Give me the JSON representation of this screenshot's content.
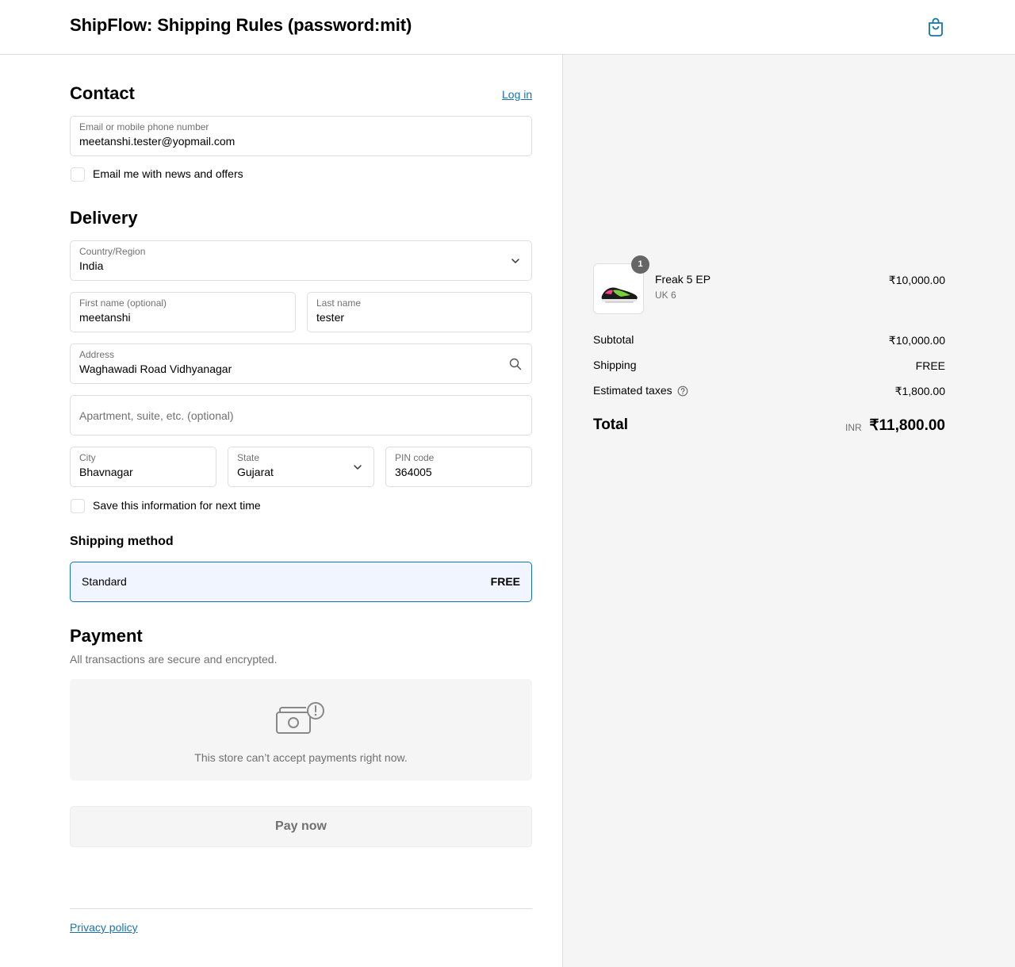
{
  "header": {
    "title": "ShipFlow: Shipping Rules (password:mit)",
    "cart_icon": "shopping-bag-icon"
  },
  "contact": {
    "heading": "Contact",
    "login_label": "Log in",
    "email": {
      "label": "Email or mobile phone number",
      "value": "meetanshi.tester@yopmail.com"
    },
    "news_label": "Email me with news and offers"
  },
  "delivery": {
    "heading": "Delivery",
    "country": {
      "label": "Country/Region",
      "value": "India"
    },
    "first_name": {
      "label": "First name (optional)",
      "value": "meetanshi"
    },
    "last_name": {
      "label": "Last name",
      "value": "tester"
    },
    "address": {
      "label": "Address",
      "value": "Waghawadi Road Vidhyanagar"
    },
    "apartment": {
      "placeholder": "Apartment, suite, etc. (optional)"
    },
    "city": {
      "label": "City",
      "value": "Bhavnagar"
    },
    "state": {
      "label": "State",
      "value": "Gujarat"
    },
    "pin": {
      "label": "PIN code",
      "value": "364005"
    },
    "save_label": "Save this information for next time"
  },
  "shipping_method": {
    "heading": "Shipping method",
    "option": {
      "name": "Standard",
      "price": "FREE"
    }
  },
  "payment": {
    "heading": "Payment",
    "subtitle": "All transactions are secure and encrypted.",
    "unavailable_message": "This store can’t accept payments right now.",
    "pay_label": "Pay now"
  },
  "footer": {
    "privacy_label": "Privacy policy"
  },
  "summary": {
    "item": {
      "name": "Freak 5 EP",
      "variant": "UK 6",
      "price": "₹10,000.00",
      "quantity": "1"
    },
    "subtotal": {
      "label": "Subtotal",
      "value": "₹10,000.00"
    },
    "shipping": {
      "label": "Shipping",
      "value": "FREE"
    },
    "taxes": {
      "label": "Estimated taxes",
      "value": "₹1,800.00"
    },
    "total": {
      "label": "Total",
      "currency": "INR",
      "value": "₹11,800.00"
    }
  },
  "colors": {
    "accent": "#1773b0",
    "selected_bg": "#f0f5ff",
    "summary_bg": "#f5f5f5"
  }
}
